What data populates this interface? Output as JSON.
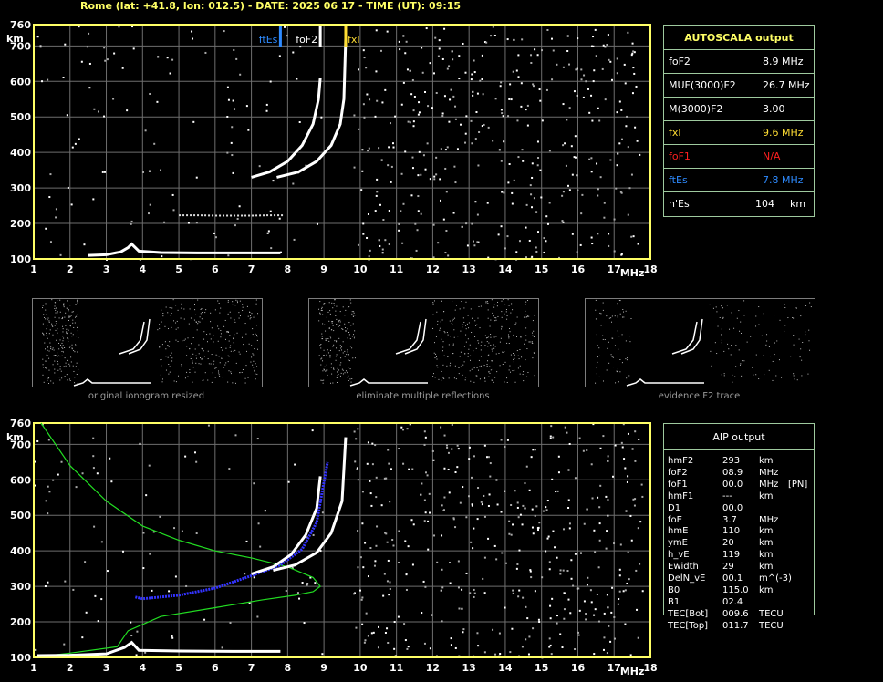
{
  "header": {
    "title": "Rome (lat: +41.8, lon: 012.5) - DATE: 2025 06 17 - TIME (UT): 09:15"
  },
  "colors": {
    "axis": "#ffff66",
    "grid": "#6e6e6e",
    "panel_border": "#9ec99e",
    "ftEs": "#2e8bff",
    "fxI": "#ffdd33",
    "foF1": "#ff2020",
    "profile": "#22dd22",
    "trace_fit": "#3333ff"
  },
  "chart_data": [
    {
      "type": "scatter",
      "title": "",
      "xlabel": "MHz",
      "ylabel": "km",
      "xlim": [
        1,
        18
      ],
      "ylim": [
        100,
        760
      ],
      "x_ticks": [
        "1",
        "2",
        "3",
        "4",
        "5",
        "6",
        "7",
        "8",
        "9",
        "10",
        "11",
        "12",
        "13",
        "14",
        "15",
        "16",
        "17",
        "18"
      ],
      "y_ticks": [
        "100",
        "200",
        "300",
        "400",
        "500",
        "600",
        "700",
        "760"
      ],
      "grid": true,
      "markers": [
        {
          "name": "ftEs",
          "x": 7.8,
          "color": "#2e8bff"
        },
        {
          "name": "foF2",
          "x": 8.9,
          "color": "#ffffff"
        },
        {
          "name": "fxI",
          "x": 9.6,
          "color": "#ffdd33"
        }
      ],
      "series": [
        {
          "name": "Es layer",
          "x": [
            2.5,
            3.0,
            3.4,
            3.6,
            3.7,
            3.9,
            4.5,
            5.5,
            6.5,
            7.3,
            7.8
          ],
          "y": [
            110,
            112,
            120,
            132,
            142,
            122,
            118,
            117,
            117,
            117,
            117
          ]
        },
        {
          "name": "Es multiple",
          "x": [
            5.0,
            5.5,
            6.0,
            6.5,
            7.0,
            7.5,
            7.9
          ],
          "y": [
            223,
            223,
            222,
            222,
            222,
            223,
            223
          ]
        },
        {
          "name": "O trace",
          "x": [
            7.0,
            7.5,
            8.0,
            8.4,
            8.7,
            8.85,
            8.9
          ],
          "y": [
            330,
            345,
            375,
            420,
            480,
            550,
            610
          ]
        },
        {
          "name": "X trace",
          "x": [
            7.7,
            8.3,
            8.8,
            9.2,
            9.45,
            9.55,
            9.6
          ],
          "y": [
            330,
            345,
            375,
            420,
            480,
            550,
            720
          ]
        }
      ]
    },
    {
      "type": "line",
      "title": "",
      "xlabel": "MHz",
      "ylabel": "km",
      "xlim": [
        1,
        18
      ],
      "ylim": [
        100,
        760
      ],
      "x_ticks": [
        "1",
        "2",
        "3",
        "4",
        "5",
        "6",
        "7",
        "8",
        "9",
        "10",
        "11",
        "12",
        "13",
        "14",
        "15",
        "16",
        "17",
        "18"
      ],
      "y_ticks": [
        "100",
        "200",
        "300",
        "400",
        "500",
        "600",
        "700",
        "760"
      ],
      "grid": true,
      "series": [
        {
          "name": "electron density profile",
          "x": [
            1.2,
            2.0,
            3.0,
            4.0,
            5.0,
            6.0,
            7.0,
            8.0,
            8.7,
            8.9,
            8.7,
            8.2,
            7.3,
            6.0,
            4.5,
            3.6,
            3.3,
            2.0,
            1.2
          ],
          "y": [
            760,
            640,
            540,
            470,
            430,
            400,
            380,
            355,
            325,
            300,
            285,
            275,
            262,
            240,
            215,
            175,
            130,
            112,
            103
          ]
        },
        {
          "name": "virtual height fit",
          "x": [
            3.8,
            4.0,
            5.0,
            6.0,
            7.0,
            7.8,
            8.4,
            8.8,
            9.1
          ],
          "y": [
            270,
            265,
            275,
            295,
            330,
            360,
            405,
            480,
            650
          ]
        },
        {
          "name": "O trace",
          "x": [
            7.0,
            7.6,
            8.1,
            8.5,
            8.8,
            8.9
          ],
          "y": [
            335,
            355,
            390,
            445,
            520,
            610
          ]
        },
        {
          "name": "X trace",
          "x": [
            7.6,
            8.2,
            8.8,
            9.2,
            9.5,
            9.6
          ],
          "y": [
            345,
            360,
            395,
            450,
            540,
            720
          ]
        },
        {
          "name": "Es layer",
          "x": [
            1.1,
            2.0,
            3.0,
            3.5,
            3.7,
            3.9,
            5.0,
            6.5,
            7.8
          ],
          "y": [
            105,
            106,
            110,
            128,
            142,
            120,
            118,
            117,
            117
          ]
        }
      ]
    }
  ],
  "autoscala": {
    "title": "AUTOSCALA output",
    "rows": [
      {
        "label": "foF2",
        "value": "8.9 MHz",
        "color": "#ffffff"
      },
      {
        "label": "MUF(3000)F2",
        "value": "26.7 MHz",
        "color": "#ffffff"
      },
      {
        "label": "M(3000)F2",
        "value": "3.00",
        "color": "#ffffff"
      },
      {
        "label": "fxI",
        "value": "9.6 MHz",
        "color": "#ffdd33"
      },
      {
        "label": "foF1",
        "value": "N/A",
        "color": "#ff2020"
      },
      {
        "label": "ftEs",
        "value": "7.8 MHz",
        "color": "#2e8bff"
      },
      {
        "label": "h'Es",
        "value": "104",
        "unit": "km",
        "color": "#ffffff"
      }
    ]
  },
  "thumbnails": [
    {
      "caption": "original ionogram resized"
    },
    {
      "caption": "eliminate multiple reflections"
    },
    {
      "caption": "evidence F2 trace"
    }
  ],
  "aip": {
    "title": "AIP output",
    "rows": [
      {
        "label": "hmF2",
        "value": "293",
        "unit": "km",
        "extra": ""
      },
      {
        "label": "foF2",
        "value": "08.9",
        "unit": "MHz",
        "extra": ""
      },
      {
        "label": "foF1",
        "value": "00.0",
        "unit": "MHz",
        "extra": "[PN]"
      },
      {
        "label": "hmF1",
        "value": "---",
        "unit": "km",
        "extra": ""
      },
      {
        "label": "D1",
        "value": "00.0",
        "unit": "",
        "extra": ""
      },
      {
        "label": "foE",
        "value": "3.7",
        "unit": "MHz",
        "extra": ""
      },
      {
        "label": "hmE",
        "value": "110",
        "unit": "km",
        "extra": ""
      },
      {
        "label": "ymE",
        "value": "20",
        "unit": "km",
        "extra": ""
      },
      {
        "label": "h_vE",
        "value": "119",
        "unit": "km",
        "extra": ""
      },
      {
        "label": "Ewidth",
        "value": "29",
        "unit": "km",
        "extra": ""
      },
      {
        "label": "DelN_vE",
        "value": "00.1",
        "unit": "m^(-3)",
        "extra": ""
      },
      {
        "label": "B0",
        "value": "115.0",
        "unit": "km",
        "extra": ""
      },
      {
        "label": "B1",
        "value": "02.4",
        "unit": "",
        "extra": ""
      },
      {
        "label": "TEC[Bot]",
        "value": "009.6",
        "unit": "TECU",
        "extra": ""
      },
      {
        "label": "TEC[Top]",
        "value": "011.7",
        "unit": "TECU",
        "extra": ""
      }
    ]
  }
}
